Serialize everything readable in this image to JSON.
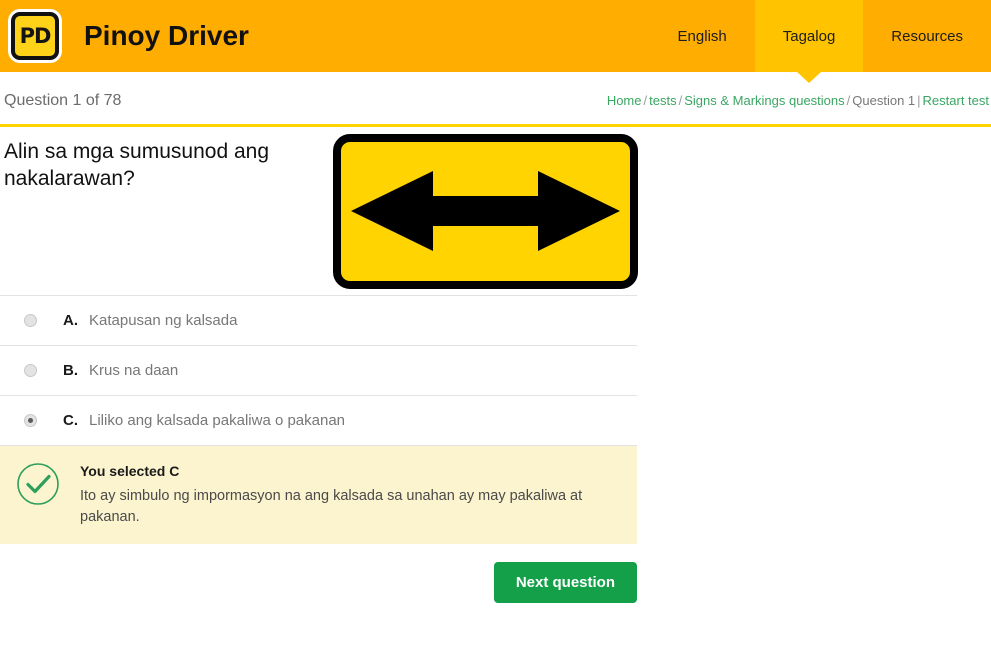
{
  "header": {
    "logo_text": "PD",
    "logo_name": "pinoy-driver-logo",
    "brand": "Pinoy Driver",
    "nav": [
      {
        "label": "English",
        "active": false
      },
      {
        "label": "Tagalog",
        "active": true
      },
      {
        "label": "Resources",
        "active": false
      }
    ]
  },
  "subbar": {
    "question_counter": "Question 1 of 78",
    "breadcrumb": {
      "home": "Home",
      "tests": "tests",
      "category": "Signs & Markings questions",
      "current": "Question 1",
      "restart": "Restart test",
      "separator": "/",
      "pipe": "|"
    }
  },
  "question": {
    "text": "Alin sa mga sumusunod ang nakalarawan?",
    "sign": {
      "name": "double-arrow-road-sign",
      "background": "#FFD400",
      "border": "#000000",
      "arrow_color": "#000000",
      "description": "Yellow rectangular sign with black double-headed horizontal arrow"
    }
  },
  "options": [
    {
      "letter": "A.",
      "text": "Katapusan ng kalsada",
      "selected": false
    },
    {
      "letter": "B.",
      "text": "Krus na daan",
      "selected": false
    },
    {
      "letter": "C.",
      "text": "Liliko ang kalsada pakaliwa o pakanan",
      "selected": true
    }
  ],
  "feedback": {
    "icon": "check-circle-icon",
    "title": "You selected C",
    "text": "Ito ay simbulo ng impormasyon na ang kalsada sa unahan ay may pakaliwa at pakanan.",
    "background": "#FBF4CF",
    "accent": "#2E9E5B"
  },
  "actions": {
    "next_label": "Next question",
    "next_color": "#13A049"
  },
  "colors": {
    "header": "#FFAD00",
    "active_tab": "#FFC300",
    "rule": "#FFD400",
    "link_green": "#3AA663"
  }
}
